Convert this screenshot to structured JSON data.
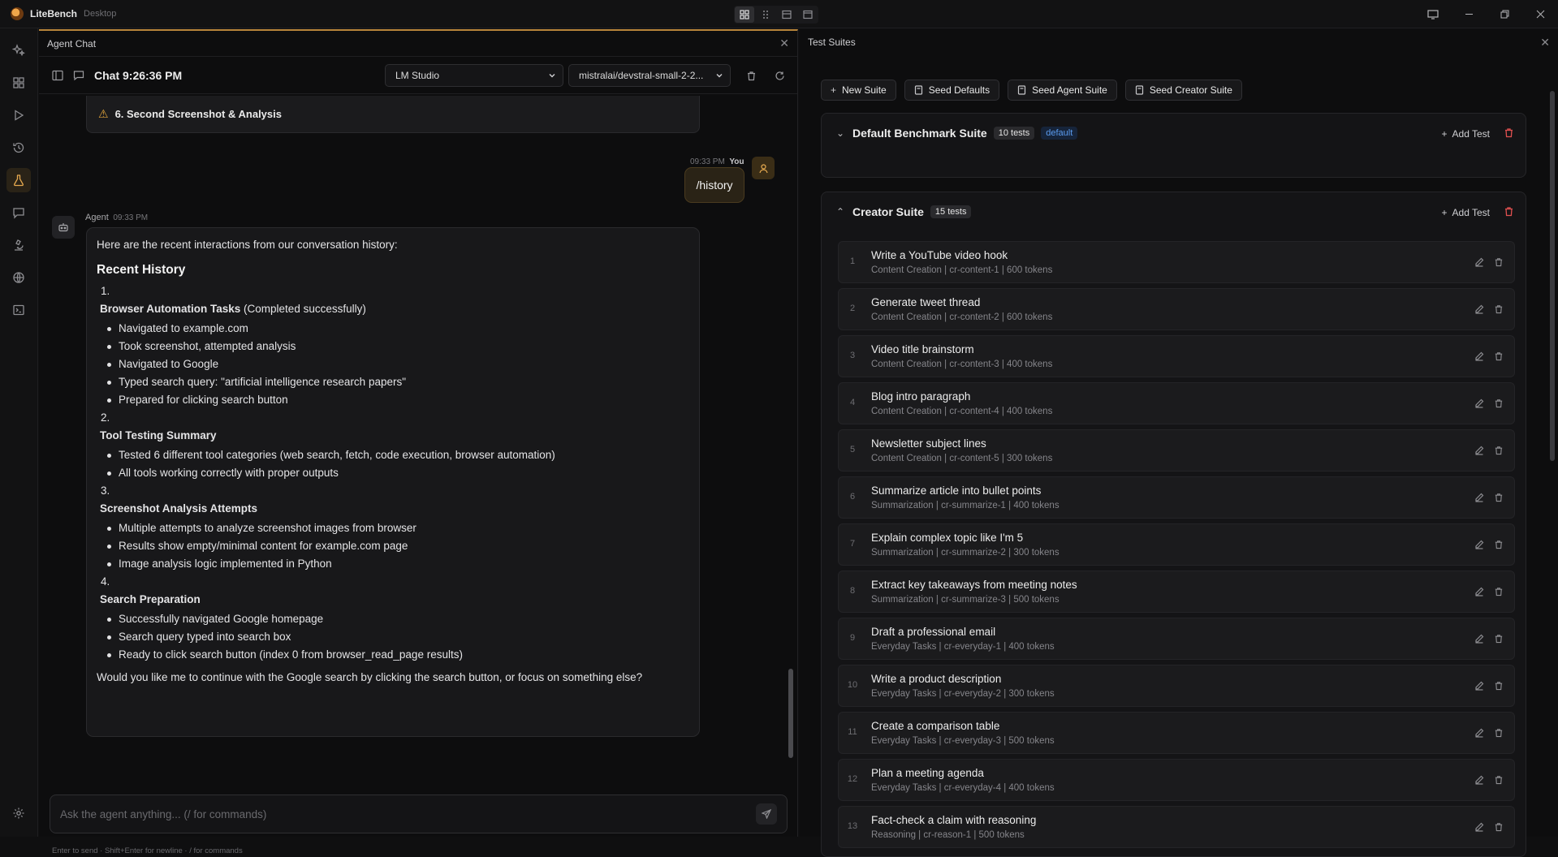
{
  "app": {
    "name": "LiteBench",
    "subtitle": "Desktop"
  },
  "chat": {
    "panel_title": "Agent Chat",
    "chat_title": "Chat 9:26:36 PM",
    "provider": "LM Studio",
    "model": "mistralai/devstral-small-2-2...",
    "warn_card": "6. Second Screenshot & Analysis",
    "user_msg": {
      "time": "09:33 PM",
      "author": "You",
      "text": "/history"
    },
    "agent_msg": {
      "author": "Agent",
      "time": "09:33 PM",
      "intro": "Here are the recent interactions from our conversation history:",
      "heading": "Recent History",
      "sections": [
        {
          "num": "1.",
          "title": "Browser Automation Tasks",
          "suffix": " (Completed successfully)",
          "items": [
            "Navigated to example.com",
            "Took screenshot, attempted analysis",
            "Navigated to Google",
            "Typed search query: \"artificial intelligence research papers\"",
            "Prepared for clicking search button"
          ]
        },
        {
          "num": "2.",
          "title": "Tool Testing Summary",
          "suffix": "",
          "items": [
            "Tested 6 different tool categories (web search, fetch, code execution, browser automation)",
            "All tools working correctly with proper outputs"
          ]
        },
        {
          "num": "3.",
          "title": "Screenshot Analysis Attempts",
          "suffix": "",
          "items": [
            "Multiple attempts to analyze screenshot images from browser",
            "Results show empty/minimal content for example.com page",
            "Image analysis logic implemented in Python"
          ]
        },
        {
          "num": "4.",
          "title": "Search Preparation",
          "suffix": "",
          "items": [
            "Successfully navigated Google homepage",
            "Search query typed into search box",
            "Ready to click search button (index 0 from browser_read_page results)"
          ]
        }
      ],
      "closing": "Would you like me to continue with the Google search by clicking the search button, or focus on something else?"
    },
    "input_placeholder": "Ask the agent anything... (/ for commands)",
    "hint": "Enter to send · Shift+Enter for newline · / for commands"
  },
  "suites": {
    "panel_title": "Test Suites",
    "actions": {
      "new_suite": "New Suite",
      "seed_defaults": "Seed Defaults",
      "seed_agent": "Seed Agent Suite",
      "seed_creator": "Seed Creator Suite"
    },
    "default_suite": {
      "name": "Default Benchmark Suite",
      "count": "10 tests",
      "badge": "default",
      "add_test": "Add Test"
    },
    "creator_suite": {
      "name": "Creator Suite",
      "count": "15 tests",
      "add_test": "Add Test",
      "tests": [
        {
          "idx": "1",
          "title": "Write a YouTube video hook",
          "sub": "Content Creation | cr-content-1 | 600 tokens"
        },
        {
          "idx": "2",
          "title": "Generate tweet thread",
          "sub": "Content Creation | cr-content-2 | 600 tokens"
        },
        {
          "idx": "3",
          "title": "Video title brainstorm",
          "sub": "Content Creation | cr-content-3 | 400 tokens"
        },
        {
          "idx": "4",
          "title": "Blog intro paragraph",
          "sub": "Content Creation | cr-content-4 | 400 tokens"
        },
        {
          "idx": "5",
          "title": "Newsletter subject lines",
          "sub": "Content Creation | cr-content-5 | 300 tokens"
        },
        {
          "idx": "6",
          "title": "Summarize article into bullet points",
          "sub": "Summarization | cr-summarize-1 | 400 tokens"
        },
        {
          "idx": "7",
          "title": "Explain complex topic like I'm 5",
          "sub": "Summarization | cr-summarize-2 | 300 tokens"
        },
        {
          "idx": "8",
          "title": "Extract key takeaways from meeting notes",
          "sub": "Summarization | cr-summarize-3 | 500 tokens"
        },
        {
          "idx": "9",
          "title": "Draft a professional email",
          "sub": "Everyday Tasks | cr-everyday-1 | 400 tokens"
        },
        {
          "idx": "10",
          "title": "Write a product description",
          "sub": "Everyday Tasks | cr-everyday-2 | 300 tokens"
        },
        {
          "idx": "11",
          "title": "Create a comparison table",
          "sub": "Everyday Tasks | cr-everyday-3 | 500 tokens"
        },
        {
          "idx": "12",
          "title": "Plan a meeting agenda",
          "sub": "Everyday Tasks | cr-everyday-4 | 400 tokens"
        },
        {
          "idx": "13",
          "title": "Fact-check a claim with reasoning",
          "sub": "Reasoning | cr-reason-1 | 500 tokens"
        }
      ]
    }
  }
}
